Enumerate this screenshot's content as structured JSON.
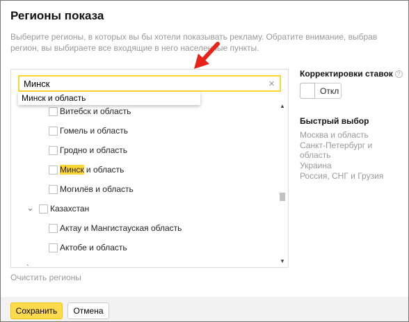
{
  "dialog": {
    "title": "Регионы показа",
    "subtitle": "Выберите регионы, в которых вы бы хотели показывать рекламу. Обратите внимание, выбрав регион, вы выбираете все входящие в него населенные пункты."
  },
  "search": {
    "value": "Минск",
    "clear_icon": "×"
  },
  "suggestion": {
    "label": "Минск и область"
  },
  "tree": {
    "vitebsk": "Витебск и область",
    "gomel": "Гомель и область",
    "grodno": "Гродно и область",
    "minsk_match": "Минск",
    "minsk_rest": " и область",
    "mogilev": "Могилёв и область",
    "kazakhstan": "Казахстан",
    "aktau": "Актау и Мангистауская область",
    "aktobe": "Актобе и область"
  },
  "clear_regions": "Очистить регионы",
  "bid_adjustments": {
    "heading": "Корректировки ставок",
    "help": "?",
    "toggle_label": "Откл"
  },
  "quick_select": {
    "heading": "Быстрый выбор",
    "items": [
      "Москва и область",
      "Санкт-Петербург и область",
      "Украина",
      "Россия, СНГ и Грузия"
    ]
  },
  "footer": {
    "save": "Сохранить",
    "cancel": "Отмена"
  },
  "colors": {
    "accent": "#ffdb4d",
    "highlight": "#ffd633",
    "annotation_arrow": "#e8231c"
  }
}
